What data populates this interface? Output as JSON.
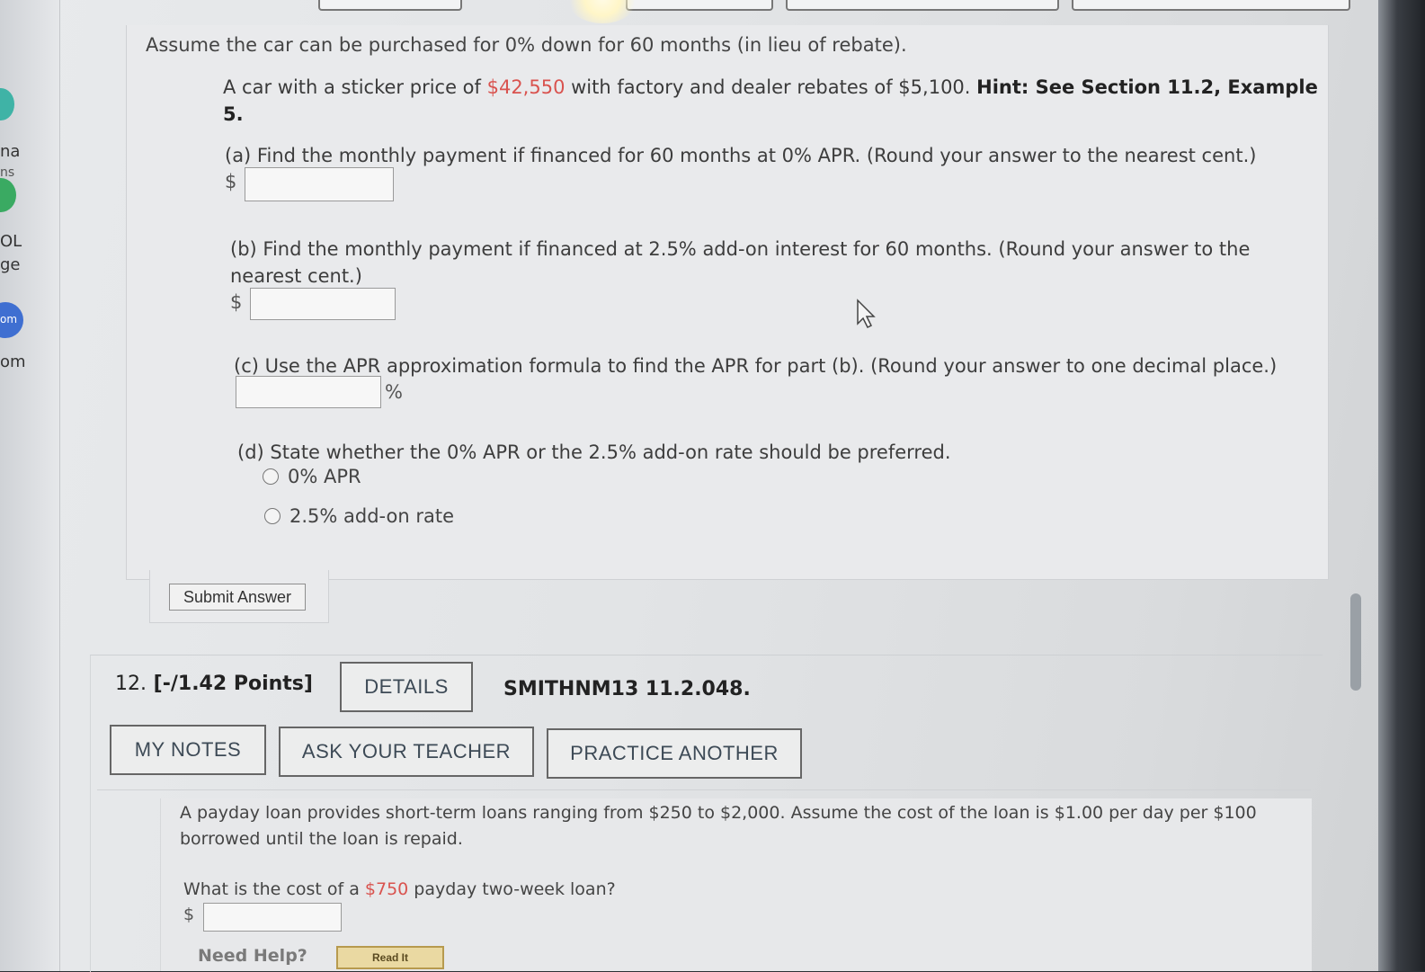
{
  "sidebar": {
    "fragments": [
      "na",
      "ns",
      "OL",
      "ge",
      "om",
      "om"
    ]
  },
  "question11": {
    "intro": "Assume the car can be purchased for 0% down for 60 months (in lieu of rebate).",
    "text_prefix": "A car with a sticker price of ",
    "sticker_price": "$42,550",
    "text_mid": " with factory and dealer rebates of $5,100. ",
    "hint": "Hint: See Section 11.2, Example 5.",
    "part_a": "(a) Find the monthly payment if financed for 60 months at 0% APR. (Round your answer to the nearest cent.)",
    "part_b": "(b) Find the monthly payment if financed at 2.5% add-on interest for 60 months. (Round your answer to the nearest cent.)",
    "part_c": "(c) Use the APR approximation formula to find the APR for part (b). (Round your answer to one decimal place.)",
    "part_d": "(d) State whether the 0% APR or the 2.5% add-on rate should be preferred.",
    "currency_symbol": "$",
    "percent_symbol": "%",
    "option_1": "0% APR",
    "option_2": "2.5% add-on rate",
    "submit_label": "Submit Answer"
  },
  "question12": {
    "number": "12.",
    "points": "[-/1.42 Points]",
    "details_label": "DETAILS",
    "code": "SMITHNM13 11.2.048.",
    "my_notes_label": "MY NOTES",
    "ask_teacher_label": "ASK YOUR TEACHER",
    "practice_label": "PRACTICE ANOTHER",
    "text": "A payday loan provides short-term loans ranging from $250 to $2,000. Assume the cost of the loan is $1.00 per day per $100 borrowed until the loan is repaid.",
    "question_prefix": "What is the cost of a ",
    "loan_amount": "$750",
    "question_suffix": " payday two-week loan?",
    "currency_symbol": "$",
    "need_help": "Need Help?",
    "read_it": "Read It"
  },
  "colors": {
    "highlight_red": "#d9534f",
    "button_text": "#3d4a56"
  }
}
